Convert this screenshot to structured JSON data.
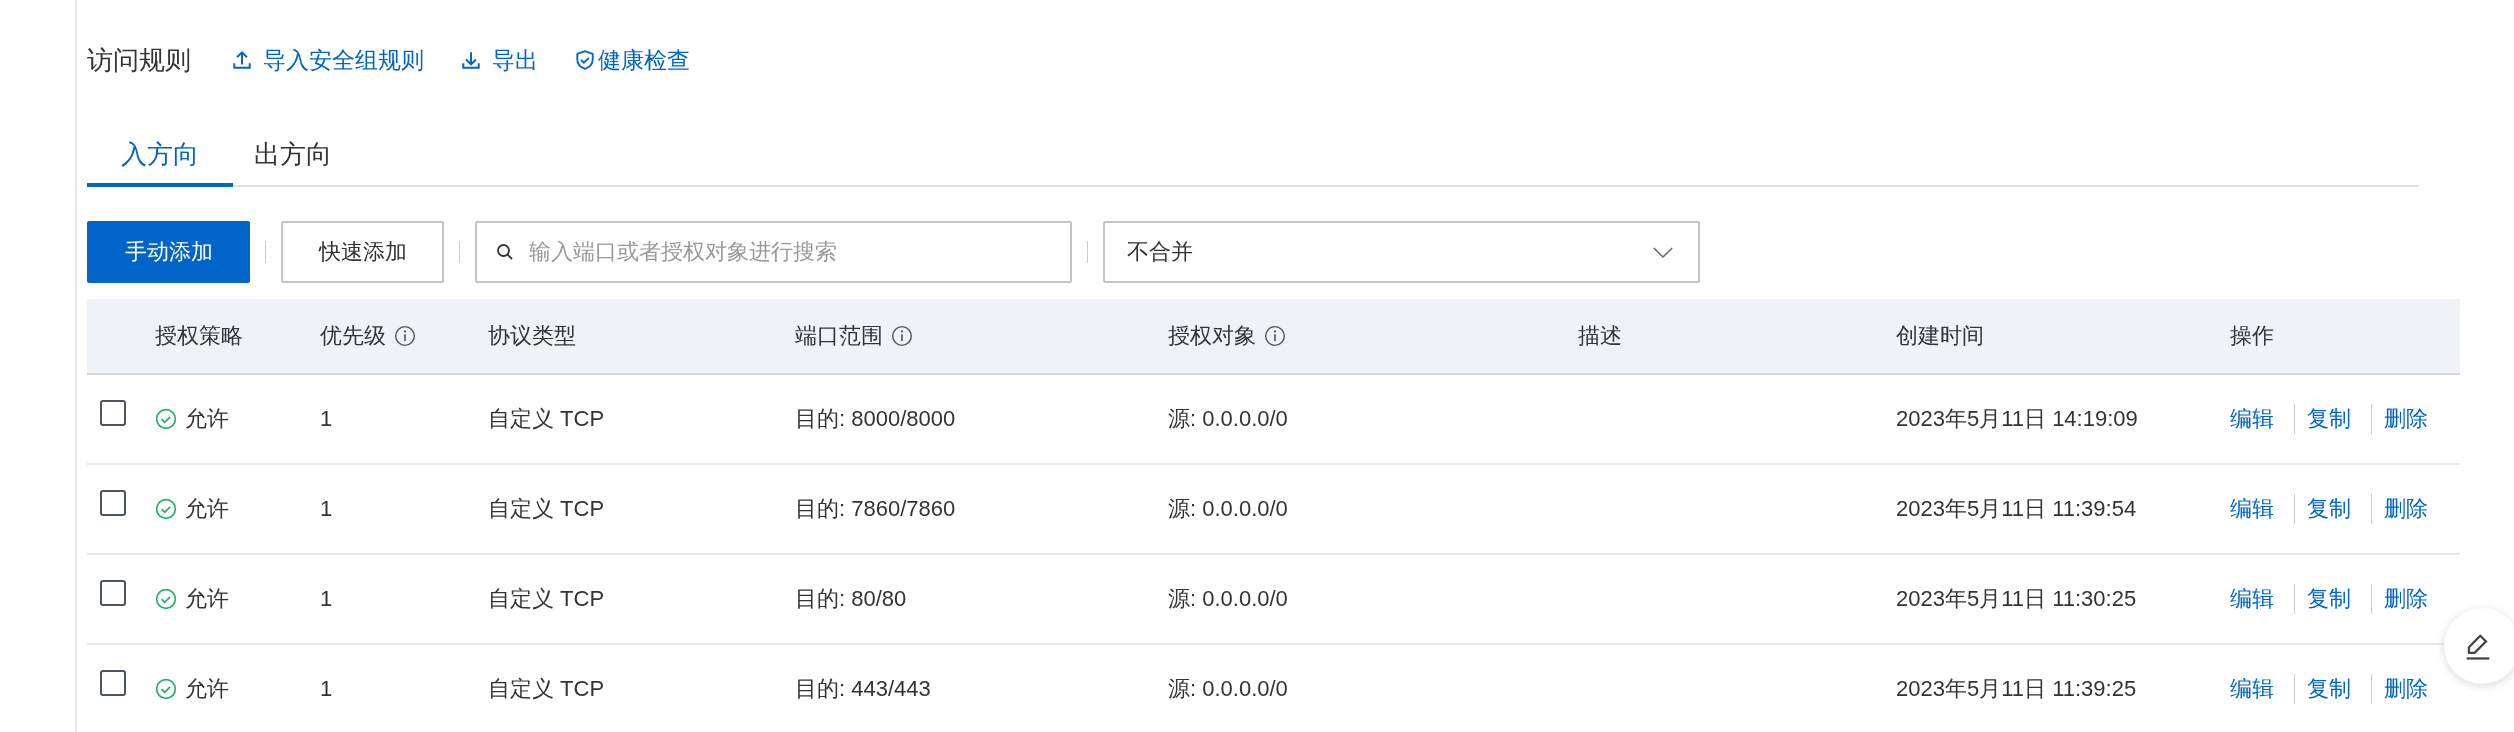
{
  "header": {
    "title": "访问规则",
    "actions": [
      {
        "label": "导入安全组规则"
      },
      {
        "label": "导出"
      },
      {
        "label": "健康检查"
      }
    ]
  },
  "tabs": [
    {
      "label": "入方向",
      "selected": true
    },
    {
      "label": "出方向",
      "selected": false
    }
  ],
  "toolbar": {
    "buttons": [
      {
        "label": "手动添加",
        "kind": "primary"
      },
      {
        "label": "快速添加",
        "kind": "default"
      }
    ],
    "search": {
      "placeholder": "输入端口或者授权对象进行搜索"
    },
    "select": {
      "value": "不合并"
    }
  },
  "table": {
    "columns": [
      {
        "label": "授权策略",
        "info": false
      },
      {
        "label": "优先级",
        "info": true
      },
      {
        "label": "协议类型",
        "info": false
      },
      {
        "label": "端口范围",
        "info": true
      },
      {
        "label": "授权对象",
        "info": true
      },
      {
        "label": "描述",
        "info": false
      },
      {
        "label": "创建时间",
        "info": false
      },
      {
        "label": "操作",
        "info": false
      }
    ],
    "rows": [
      {
        "checked": false,
        "policy": "允许",
        "priority": "1",
        "protocol": "自定义 TCP",
        "port": "目的: 8000/8000",
        "source": "源: 0.0.0.0/0",
        "created": "2023年5月11日 14:19:09",
        "actions": [
          "编辑",
          "复制",
          "删除"
        ]
      },
      {
        "checked": false,
        "policy": "允许",
        "priority": "1",
        "protocol": "自定义 TCP",
        "port": "目的: 7860/7860",
        "source": "源: 0.0.0.0/0",
        "created": "2023年5月11日 11:39:54",
        "actions": [
          "编辑",
          "复制",
          "删除"
        ]
      },
      {
        "checked": false,
        "policy": "允许",
        "priority": "1",
        "protocol": "自定义 TCP",
        "port": "目的: 80/80",
        "source": "源: 0.0.0.0/0",
        "created": "2023年5月11日 11:30:25",
        "actions": [
          "编辑",
          "复制",
          "删除"
        ]
      },
      {
        "checked": false,
        "policy": "允许",
        "priority": "1",
        "protocol": "自定义 TCP",
        "port": "目的: 443/443",
        "source": "源: 0.0.0.0/0",
        "created": "2023年5月11日 11:39:25",
        "actions": [
          "编辑",
          "复制",
          "删除"
        ]
      }
    ]
  }
}
